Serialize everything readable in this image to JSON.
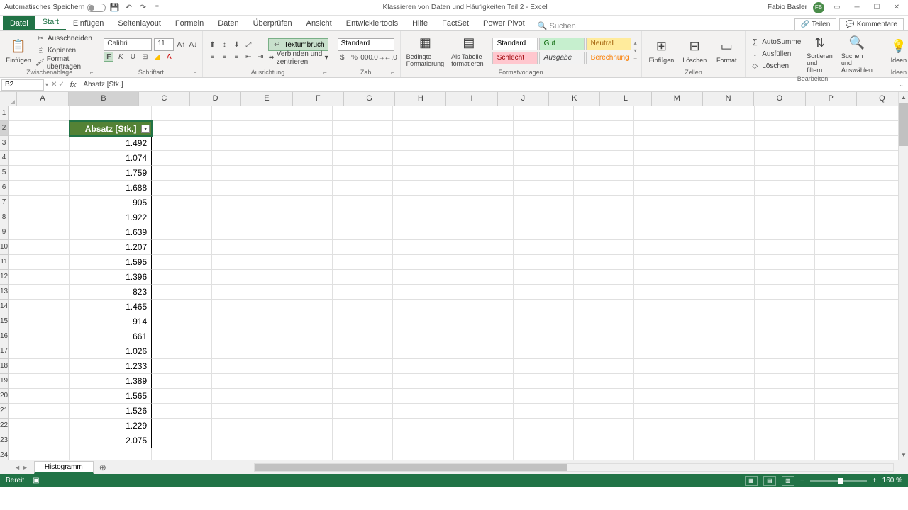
{
  "titlebar": {
    "autosave": "Automatisches Speichern",
    "title": "Klassieren von Daten und Häufigkeiten Teil 2 - Excel",
    "user": "Fabio Basler",
    "initials": "FB"
  },
  "tabs": {
    "file": "Datei",
    "start": "Start",
    "einfuegen": "Einfügen",
    "seitenlayout": "Seitenlayout",
    "formeln": "Formeln",
    "daten": "Daten",
    "ueberpruefen": "Überprüfen",
    "ansicht": "Ansicht",
    "entwicklertools": "Entwicklertools",
    "hilfe": "Hilfe",
    "factset": "FactSet",
    "powerpivot": "Power Pivot",
    "search": "Suchen",
    "teilen": "Teilen",
    "kommentare": "Kommentare"
  },
  "ribbon": {
    "zwischenablage": {
      "label": "Zwischenablage",
      "einfuegen": "Einfügen",
      "ausschneiden": "Ausschneiden",
      "kopieren": "Kopieren",
      "format": "Format übertragen"
    },
    "schriftart": {
      "label": "Schriftart",
      "font": "Calibri",
      "size": "11"
    },
    "ausrichtung": {
      "label": "Ausrichtung",
      "textumbruch": "Textumbruch",
      "verbinden": "Verbinden und zentrieren"
    },
    "zahl": {
      "label": "Zahl",
      "format": "Standard"
    },
    "formatvorlagen": {
      "label": "Formatvorlagen",
      "bedingte": "Bedingte Formatierung",
      "alstabelle": "Als Tabelle formatieren",
      "standard": "Standard",
      "gut": "Gut",
      "neutral": "Neutral",
      "schlecht": "Schlecht",
      "ausgabe": "Ausgabe",
      "berechnung": "Berechnung"
    },
    "zellen": {
      "label": "Zellen",
      "einfuegen": "Einfügen",
      "loeschen": "Löschen",
      "format": "Format"
    },
    "bearbeiten": {
      "label": "Bearbeiten",
      "autosumme": "AutoSumme",
      "ausfuellen": "Ausfüllen",
      "loeschen": "Löschen",
      "sortieren": "Sortieren und filtern",
      "suchen": "Suchen und Auswählen"
    },
    "ideen": {
      "label": "Ideen",
      "btn": "Ideen"
    }
  },
  "formula": {
    "namebox": "B2",
    "value": "Absatz  [Stk.]"
  },
  "columns": [
    "A",
    "B",
    "C",
    "D",
    "E",
    "F",
    "G",
    "H",
    "I",
    "J",
    "K",
    "L",
    "M",
    "N",
    "O",
    "P",
    "Q"
  ],
  "table": {
    "header": "Absatz  [Stk.]",
    "rows": [
      "1.492",
      "1.074",
      "1.759",
      "1.688",
      "905",
      "1.922",
      "1.639",
      "1.207",
      "1.595",
      "1.396",
      "823",
      "1.465",
      "914",
      "661",
      "1.026",
      "1.233",
      "1.389",
      "1.565",
      "1.526",
      "1.229",
      "2.075"
    ]
  },
  "sheets": {
    "active": "Histogramm"
  },
  "statusbar": {
    "ready": "Bereit",
    "zoom": "160 %"
  }
}
